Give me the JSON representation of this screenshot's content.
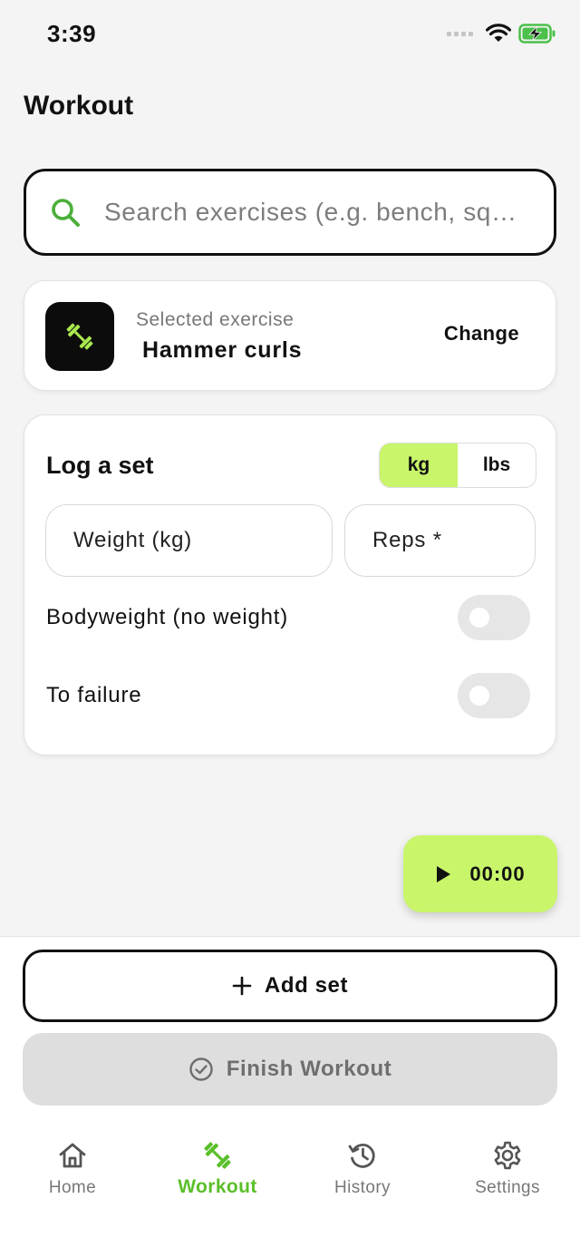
{
  "status_bar": {
    "time": "3:39"
  },
  "header": {
    "title": "Workout"
  },
  "search": {
    "placeholder": "Search exercises (e.g. bench, sq…"
  },
  "selected_exercise": {
    "caption": "Selected exercise",
    "name": "Hammer curls",
    "change_label": "Change",
    "icon": "dumbbell-icon"
  },
  "log_set": {
    "title": "Log a set",
    "units": [
      "kg",
      "lbs"
    ],
    "selected_unit": "kg",
    "weight_placeholder": "Weight (kg)",
    "reps_placeholder": "Reps *",
    "bodyweight_label": "Bodyweight (no weight)",
    "bodyweight_on": false,
    "failure_label": "To failure",
    "failure_on": false
  },
  "timer": {
    "time": "00:00",
    "icon": "play-icon"
  },
  "actions": {
    "add_set_label": "Add set",
    "finish_label": "Finish Workout"
  },
  "tabs": [
    {
      "label": "Home",
      "icon": "home-icon",
      "active": false
    },
    {
      "label": "Workout",
      "icon": "dumbbell-icon",
      "active": true
    },
    {
      "label": "History",
      "icon": "history-icon",
      "active": false
    },
    {
      "label": "Settings",
      "icon": "gear-icon",
      "active": false
    }
  ],
  "colors": {
    "accent": "#c8f56a",
    "active_tab": "#5bbf2a",
    "background": "#f4f4f4"
  }
}
